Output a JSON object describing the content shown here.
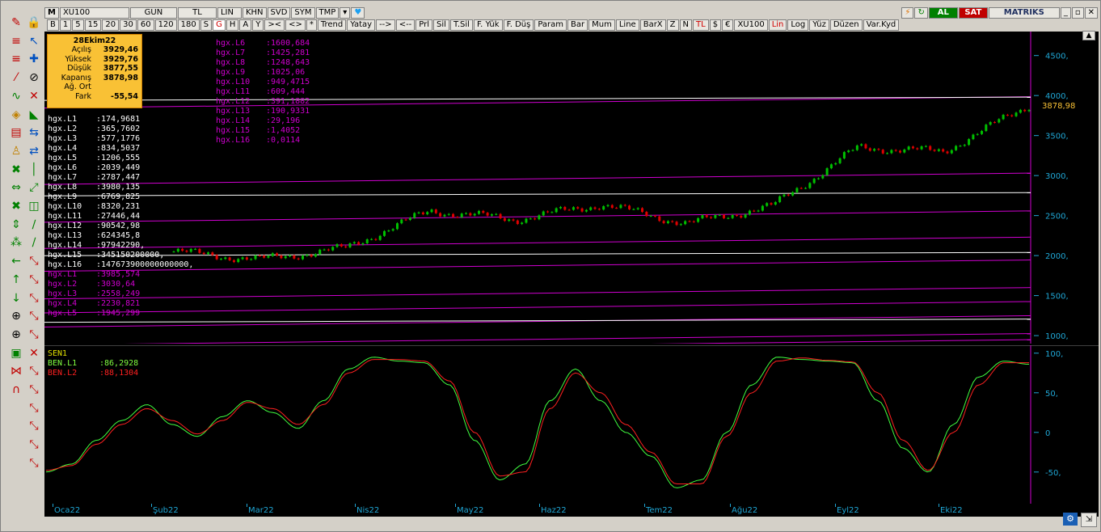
{
  "toolbar1": {
    "menu_icon": "M",
    "symbol": "XU100",
    "period": "GUN",
    "currency": "TL",
    "scale": "LIN",
    "khn": "KHN",
    "svd": "SVD",
    "sym": "SYM",
    "tmp": "TMP",
    "buy": "AL",
    "sell": "SAT",
    "brand": "MATRIKS"
  },
  "toolbar2": {
    "items": [
      "B",
      "1",
      "5",
      "15",
      "20",
      "30",
      "60",
      "120",
      "180",
      "S",
      "G",
      "H",
      "A",
      "Y",
      "><",
      "<>",
      "*",
      "Trend",
      "Yatay",
      "-->",
      "<--",
      "Prl",
      "Sil",
      "T.Sil",
      "F. Yük",
      "F. Düş",
      "Param",
      "Bar",
      "Mum",
      "Line",
      "BarX",
      "Z",
      "N",
      "TL",
      "$",
      "€",
      "XU100",
      "Lin",
      "Log",
      "Yüz",
      "Düzen",
      "Var.Kyd"
    ],
    "active": "G"
  },
  "info": {
    "date": "28Ekim22",
    "rows": [
      {
        "k": "Açılış",
        "v": "3929,46"
      },
      {
        "k": "Yüksek",
        "v": "3929,76"
      },
      {
        "k": "Düşük",
        "v": "3877,55"
      },
      {
        "k": "Kapanış",
        "v": "3878,98"
      },
      {
        "k": "Ağ. Ort",
        "v": ""
      },
      {
        "k": "Fark",
        "v": "-55,54"
      }
    ]
  },
  "levels_white": [
    {
      "n": "hgx.L1",
      "v": ":174,9681"
    },
    {
      "n": "hgx.L2",
      "v": ":365,7602"
    },
    {
      "n": "hgx.L3",
      "v": ":577,1776"
    },
    {
      "n": "hgx.L4",
      "v": ":834,5037"
    },
    {
      "n": "hgx.L5",
      "v": ":1206,555"
    },
    {
      "n": "hgx.L6",
      "v": ":2039,449"
    },
    {
      "n": "hgx.L7",
      "v": ":2787,447"
    },
    {
      "n": "hgx.L8",
      "v": ":3980,135"
    },
    {
      "n": "hgx.L9",
      "v": ":6769,825"
    },
    {
      "n": "hgx.L10",
      "v": ":8320,231"
    },
    {
      "n": "hgx.L11",
      "v": ":27446,44"
    },
    {
      "n": "hgx.L12",
      "v": ":90542,98"
    },
    {
      "n": "hgx.L13",
      "v": ":624345,8"
    },
    {
      "n": "hgx.L14",
      "v": ":97942290,"
    },
    {
      "n": "hgx.L15",
      "v": ":345150200000,"
    },
    {
      "n": "hgx.L16",
      "v": ":147673900000000000,"
    }
  ],
  "levels_magenta_left": [
    {
      "n": "hgx.L1",
      "v": ":3985,574"
    },
    {
      "n": "hgx.L2",
      "v": ":3030,64"
    },
    {
      "n": "hgx.L3",
      "v": ":2558,249"
    },
    {
      "n": "hgx.L4",
      "v": ":2230,821"
    },
    {
      "n": "hgx.L5",
      "v": ":1945,299"
    }
  ],
  "levels_magenta_top": [
    {
      "n": "hgx.L6",
      "v": ":1600,684"
    },
    {
      "n": "hgx.L7",
      "v": ":1425,281"
    },
    {
      "n": "hgx.L8",
      "v": ":1248,643"
    },
    {
      "n": "hgx.L9",
      "v": ":1025,06"
    },
    {
      "n": "hgx.L10",
      "v": ":949,4715"
    },
    {
      "n": "hgx.L11",
      "v": ":609,444"
    },
    {
      "n": "hgx.L12",
      "v": ":391,1882"
    },
    {
      "n": "hgx.L13",
      "v": ":190,9331"
    },
    {
      "n": "hgx.L14",
      "v": ":29,196"
    },
    {
      "n": "hgx.L15",
      "v": ":1,4052"
    },
    {
      "n": "hgx.L16",
      "v": ":0,0114"
    }
  ],
  "oscillator": {
    "name": "SEN1",
    "l1_label": "BEN.L1",
    "l1_value": ":86,2928",
    "l2_label": "BEN.L2",
    "l2_value": ":88,1304"
  },
  "colors": {
    "up": "#00c000",
    "down": "#e00000",
    "magenta": "#d000d0",
    "axis": "#1fa7d6",
    "last_price": "#f9c135"
  },
  "last_price_label": "3878,98",
  "chart_data": [
    {
      "type": "line",
      "name": "price",
      "x": [
        "Oca22",
        "Şub22",
        "Mar22",
        "Nis22",
        "May22",
        "Haz22",
        "Tem22",
        "Ağu22",
        "Eyl22",
        "Eki22"
      ],
      "y_ticks": [
        "4500,",
        "4000,",
        "3500,",
        "3000,",
        "2500,",
        "2000,",
        "1500,",
        "1000,"
      ],
      "ylim": [
        900,
        4800
      ],
      "close_by_month_start": [
        2050,
        1950,
        2090,
        2560,
        2450,
        2640,
        2400,
        2620,
        3350,
        3300
      ],
      "last_close": 3878.98,
      "horizontal_levels": [
        3985.574,
        3030.64,
        2558.249,
        2230.821,
        1945.299,
        1600.684,
        1425.281,
        1248.643,
        1025.06,
        949.4715,
        2787.447,
        2039.449,
        1206.555,
        3980.135
      ]
    },
    {
      "type": "line",
      "name": "oscillator",
      "y_ticks": [
        "100,",
        "50,",
        "0",
        "-50,"
      ],
      "ylim": [
        -90,
        110
      ],
      "series": [
        {
          "name": "BEN.L1",
          "values": [
            -50,
            -40,
            -10,
            15,
            35,
            10,
            -5,
            20,
            40,
            25,
            5,
            40,
            80,
            95,
            90,
            88,
            60,
            -10,
            -60,
            -40,
            40,
            80,
            40,
            0,
            -30,
            -70,
            -60,
            0,
            60,
            95,
            92,
            90,
            88,
            40,
            -20,
            -50,
            10,
            70,
            90,
            86
          ]
        },
        {
          "name": "BEN.L2",
          "values": [
            -48,
            -42,
            -15,
            10,
            30,
            15,
            -2,
            15,
            38,
            30,
            10,
            35,
            75,
            92,
            92,
            90,
            65,
            0,
            -55,
            -50,
            30,
            75,
            50,
            10,
            -25,
            -65,
            -65,
            -5,
            50,
            90,
            94,
            91,
            89,
            50,
            -10,
            -48,
            0,
            60,
            88,
            88
          ]
        }
      ]
    }
  ]
}
